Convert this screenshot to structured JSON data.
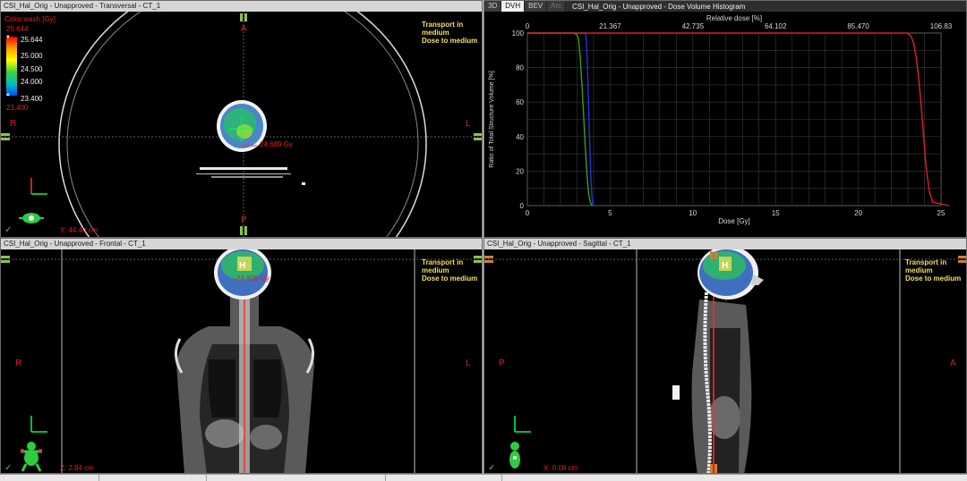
{
  "transversal": {
    "title": "CSI_Hal_Orig  -  Unapproved - Transversal - CT_1",
    "color_wash_label": "Color wash [Gy]",
    "wash_max": "25.644",
    "wash_ticks": [
      "25.644",
      "25.000",
      "24.500",
      "24.000",
      "23.400"
    ],
    "wash_min": "23.400",
    "transport_lines": [
      "Transport in",
      "medium",
      "Dose to medium"
    ],
    "orient": {
      "top": "A",
      "bottom": "P",
      "left": "R",
      "right": "L"
    },
    "point_dose": "24.689 Gy",
    "position": "Y: 44.40 cm"
  },
  "dvh": {
    "tabs": [
      {
        "label": "3D",
        "state": "normal"
      },
      {
        "label": "DVH",
        "state": "active"
      },
      {
        "label": "BEV",
        "state": "normal"
      },
      {
        "label": "Arc",
        "state": "disabled"
      }
    ],
    "title": "CSI_Hal_Orig  -  Unapproved - Dose Volume Histogram"
  },
  "chart_data": {
    "type": "line",
    "xlabel": "Dose [Gy]",
    "ylabel": "Ratio of Total Structure Volume [%]",
    "x2label": "Relative dose [%]",
    "xlim": [
      0,
      25
    ],
    "ylim": [
      0,
      100
    ],
    "x_ticks": [
      "0",
      "5",
      "10",
      "15",
      "20",
      "25"
    ],
    "y_ticks": [
      "100",
      "80",
      "60",
      "40",
      "20",
      "0"
    ],
    "x2_ticks": [
      "0",
      "21.367",
      "42.735",
      "64.102",
      "85.470",
      "106.83"
    ],
    "grid": true,
    "series": [
      {
        "color": "#2ca02c",
        "x": [
          0,
          2.8,
          3.0,
          3.1,
          3.2,
          3.3,
          3.4,
          3.5,
          3.6,
          3.7,
          3.8,
          3.9
        ],
        "y": [
          100,
          100,
          99,
          96,
          85,
          70,
          52,
          34,
          18,
          7,
          2,
          0
        ]
      },
      {
        "color": "#2233dd",
        "x": [
          0,
          3.5,
          3.55,
          3.6,
          3.65,
          3.7,
          3.75,
          3.8,
          3.85,
          3.9,
          3.95,
          4.0
        ],
        "y": [
          100,
          100,
          98,
          88,
          74,
          58,
          42,
          27,
          14,
          5,
          1,
          0
        ]
      },
      {
        "color": "#e02020",
        "x": [
          0,
          23.0,
          23.2,
          23.35,
          23.5,
          23.65,
          23.8,
          23.95,
          24.1,
          24.3,
          24.5,
          25.6
        ],
        "y": [
          100,
          100,
          98,
          94,
          86,
          74,
          58,
          40,
          22,
          8,
          2,
          0
        ]
      }
    ]
  },
  "frontal": {
    "title": "CSI_Hal_Orig  -  Unapproved - Frontal - CT_1",
    "transport_lines": [
      "Transport in",
      "medium",
      "Dose to medium"
    ],
    "orient": {
      "left": "R",
      "right": "L"
    },
    "point_dose": "24.828 Gy",
    "position": "Z: 2.84 cm"
  },
  "sagittal": {
    "title": "CSI_Hal_Orig  -  Unapproved - Sagittal - CT_1",
    "transport_lines": [
      "Transport in",
      "medium",
      "Dose to medium"
    ],
    "orient": {
      "left": "P",
      "right": "A"
    },
    "position": "X: 0.08 cm"
  },
  "colors": {
    "dose_wash": [
      "#ff0000",
      "#ffff00",
      "#00cc44",
      "#0066ff"
    ],
    "annotation": "#e02020",
    "transport_text": "#f2e05a"
  }
}
